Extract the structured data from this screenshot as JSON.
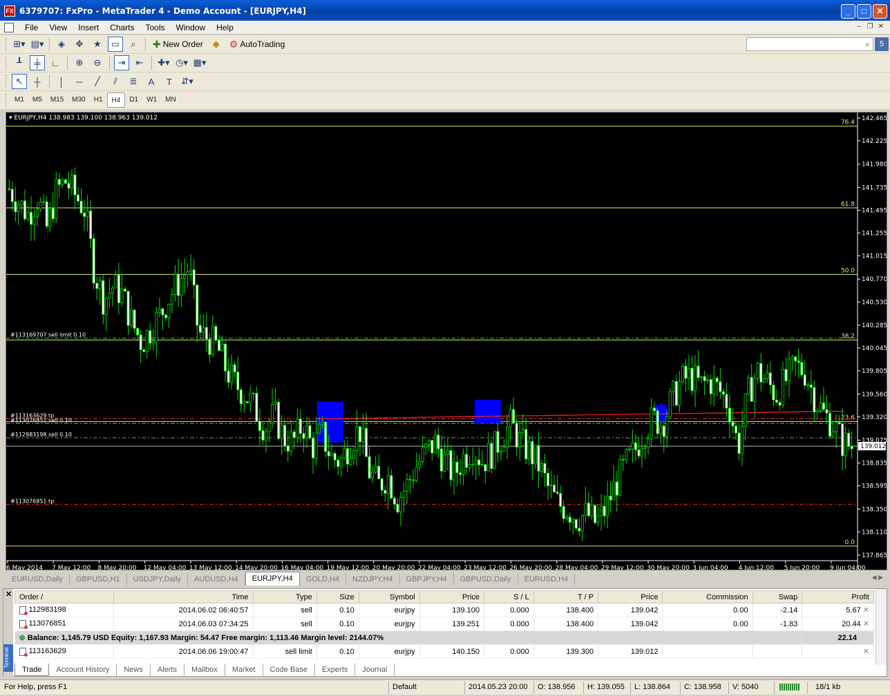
{
  "window": {
    "title": "6379707: FxPro - MetaTrader 4 - Demo Account - [EURJPY,H4]",
    "icon": "FX"
  },
  "menu": [
    "File",
    "View",
    "Insert",
    "Charts",
    "Tools",
    "Window",
    "Help"
  ],
  "toolbar": {
    "new_order": "New Order",
    "autotrading": "AutoTrading"
  },
  "timeframes": [
    "M1",
    "M5",
    "M15",
    "M30",
    "H1",
    "H4",
    "D1",
    "W1",
    "MN"
  ],
  "active_timeframe": "H4",
  "chart": {
    "header": "EURJPY,H4  138.983 139.100 138.963 139.012",
    "current_price": "139.012",
    "fib_labels": [
      "76.4",
      "61.8",
      "50.0",
      "38.2",
      "23.6",
      "0.0"
    ],
    "order_labels": [
      "#113169707 sell limit 0.10",
      "#113163629 tp",
      "#113076851 sell 0.10",
      "#112983198 sell 0.10",
      "#113076851 tp"
    ]
  },
  "chart_data": {
    "type": "candlestick",
    "symbol": "EURJPY",
    "timeframe": "H4",
    "ylim": [
      137.865,
      142.465
    ],
    "y_ticks": [
      "142.465",
      "142.225",
      "141.980",
      "141.735",
      "141.495",
      "141.255",
      "141.015",
      "140.770",
      "140.530",
      "140.285",
      "140.045",
      "139.805",
      "139.560",
      "139.320",
      "139.075",
      "138.835",
      "138.595",
      "138.350",
      "138.110",
      "137.865"
    ],
    "x_ticks": [
      "6 May 2014",
      "7 May 12:00",
      "8 May 20:00",
      "12 May 04:00",
      "13 May 12:00",
      "14 May 20:00",
      "16 May 04:00",
      "19 May 12:00",
      "20 May 20:00",
      "22 May 04:00",
      "23 May 12:00",
      "26 May 20:00",
      "28 May 04:00",
      "29 May 12:00",
      "30 May 20:00",
      "3 Jun 04:00",
      "4 Jun 12:00",
      "5 Jun 20:00",
      "9 Jun 04:00"
    ],
    "fib_levels": [
      {
        "label": "76.4",
        "price": 142.38
      },
      {
        "label": "61.8",
        "price": 141.52
      },
      {
        "label": "50.0",
        "price": 140.82
      },
      {
        "label": "38.2",
        "price": 140.13
      },
      {
        "label": "23.6",
        "price": 139.27
      },
      {
        "label": "0.0",
        "price": 137.96
      }
    ],
    "order_lines": [
      {
        "label": "#113169707 sell limit 0.10",
        "price": 140.15,
        "color": "#32cd32"
      },
      {
        "label": "#113163629 tp",
        "price": 139.3,
        "color": "#ff2020"
      },
      {
        "label": "#113076851 sell 0.10",
        "price": 139.25,
        "color": "#32cd32"
      },
      {
        "label": "#112983198 sell 0.10",
        "price": 139.1,
        "color": "#32cd32"
      },
      {
        "label": "#113076851 tp",
        "price": 138.4,
        "color": "#ff2020"
      }
    ],
    "bid_line": 139.012,
    "close_path": [
      141.72,
      141.58,
      141.45,
      141.62,
      141.3,
      141.7,
      141.8,
      141.65,
      141.5,
      140.85,
      140.55,
      140.7,
      140.6,
      140.3,
      140.1,
      140.25,
      140.4,
      140.6,
      140.75,
      140.9,
      140.2,
      140.15,
      140.05,
      139.8,
      139.65,
      139.55,
      139.4,
      139.2,
      139.35,
      139.1,
      139.05,
      139.25,
      139.0,
      139.15,
      138.9,
      138.85,
      139.05,
      139.2,
      138.75,
      138.6,
      138.7,
      138.45,
      138.6,
      138.8,
      138.95,
      139.05,
      138.85,
      138.7,
      138.9,
      139.0,
      138.85,
      138.95,
      139.1,
      139.25,
      139.05,
      138.95,
      138.8,
      138.55,
      138.4,
      138.35,
      138.25,
      138.3,
      138.2,
      138.35,
      138.6,
      138.8,
      138.95,
      139.15,
      139.3,
      139.25,
      139.5,
      139.7,
      139.75,
      139.65,
      139.7,
      139.6,
      139.45,
      139.0,
      139.55,
      139.8,
      139.7,
      139.55,
      139.7,
      139.85,
      139.8,
      139.55,
      139.35,
      139.25,
      139.05,
      139.01
    ],
    "highlight_boxes": [
      {
        "x_frac": 0.365,
        "price_top": 139.48,
        "price_bot": 139.05
      },
      {
        "x_frac": 0.55,
        "price_top": 139.5,
        "price_bot": 139.25
      },
      {
        "x_frac": 0.763,
        "price_top": 139.45,
        "price_bot": 139.27
      }
    ]
  },
  "chart_tabs": [
    "EURUSD,Daily",
    "GBPUSD,H1",
    "USDJPY,Daily",
    "AUDUSD,H4",
    "EURJPY,H4",
    "GOLD,H4",
    "NZDJPY,H4",
    "GBPJPY,H4",
    "GBPUSD,Daily",
    "EURUSD,H4"
  ],
  "active_chart_tab": "EURJPY,H4",
  "terminal": {
    "side_label": "Terminal",
    "columns": [
      "Order  /",
      "Time",
      "Type",
      "Size",
      "Symbol",
      "Price",
      "S / L",
      "T / P",
      "Price",
      "Commission",
      "Swap",
      "Profit"
    ],
    "rows": [
      [
        "112983198",
        "2014.06.02 06:40:57",
        "sell",
        "0.10",
        "eurjpy",
        "139.100",
        "0.000",
        "138.400",
        "139.042",
        "0.00",
        "-2.14",
        "5.67"
      ],
      [
        "113076851",
        "2014.06.03 07:34:25",
        "sell",
        "0.10",
        "eurjpy",
        "139.251",
        "0.000",
        "138.400",
        "139.042",
        "0.00",
        "-1.83",
        "20.44"
      ]
    ],
    "balance_text": "Balance: 1,145.79 USD  Equity: 1,167.93  Margin: 54.47  Free margin: 1,113.46  Margin level: 2144.07%",
    "balance_profit": "22.14",
    "pending": [
      "113163629",
      "2014.06.06 19:00:47",
      "sell limit",
      "0.10",
      "eurjpy",
      "140.150",
      "0.000",
      "139.300",
      "139.012",
      "",
      "",
      ""
    ],
    "tabs": [
      "Trade",
      "Account History",
      "News",
      "Alerts",
      "Mailbox",
      "Market",
      "Code Base",
      "Experts",
      "Journal"
    ],
    "active_tab": "Trade"
  },
  "status": {
    "help": "For Help, press F1",
    "profile": "Default",
    "time": "2014.05.23 20:00",
    "open": "O: 138.956",
    "high": "H: 139.055",
    "low": "L: 138.864",
    "close": "C: 138.958",
    "volume": "V: 5040",
    "traffic": "18/1 kb"
  }
}
